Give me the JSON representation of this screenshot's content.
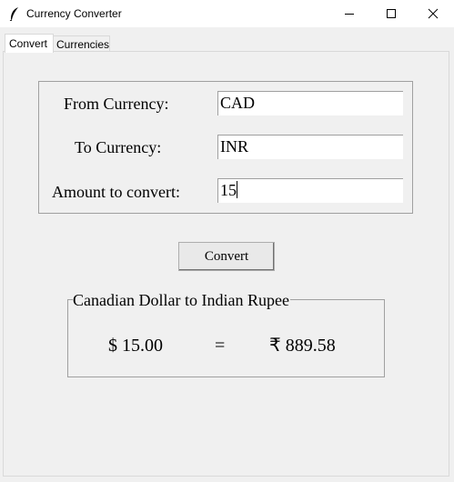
{
  "window": {
    "title": "Currency Converter",
    "app_icon": "feather-icon",
    "controls": [
      "minimize-icon",
      "maximize-icon",
      "close-icon"
    ]
  },
  "tabs": [
    {
      "label": "Convert",
      "selected": true
    },
    {
      "label": "Currencies",
      "selected": false
    }
  ],
  "form": {
    "from_label": "From Currency:",
    "from_value": "CAD",
    "to_label": "To Currency:",
    "to_value": "INR",
    "amount_label": "Amount to convert:",
    "amount_value": "15"
  },
  "convert_button": "Convert",
  "result": {
    "title": "Canadian Dollar to Indian Rupee",
    "from_amount": "$ 15.00",
    "equals": "=",
    "to_amount": "₹ 889.58"
  }
}
